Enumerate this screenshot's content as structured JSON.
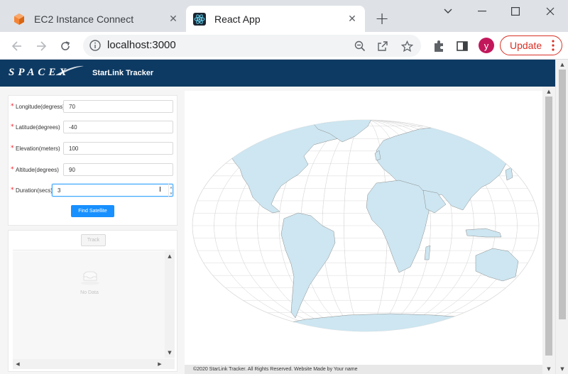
{
  "browser": {
    "tabs": [
      {
        "title": "EC2 Instance Connect",
        "active": false
      },
      {
        "title": "React App",
        "active": true
      }
    ],
    "url": "localhost:3000",
    "profile_initial": "y",
    "update_label": "Update",
    "accent_color": "#d93025"
  },
  "app": {
    "logo": "SPACEX",
    "title": "StarLink Tracker",
    "header_color": "#0d3a63"
  },
  "form": {
    "fields": [
      {
        "label": "Longitude(degress)",
        "value": "70"
      },
      {
        "label": "Latitude(degrees)",
        "value": "-40"
      },
      {
        "label": "Elevation(meters)",
        "value": "100"
      },
      {
        "label": "Altitude(degrees)",
        "value": "90"
      },
      {
        "label": "Duration(secs)",
        "value": "3"
      }
    ],
    "submit_label": "Find Satellite"
  },
  "satellite_list": {
    "track_label": "Track",
    "empty_text": "No Data"
  },
  "footer": {
    "text": "©2020 StarLink Tracker. All Rights Reserved. Website Made by Your name"
  }
}
